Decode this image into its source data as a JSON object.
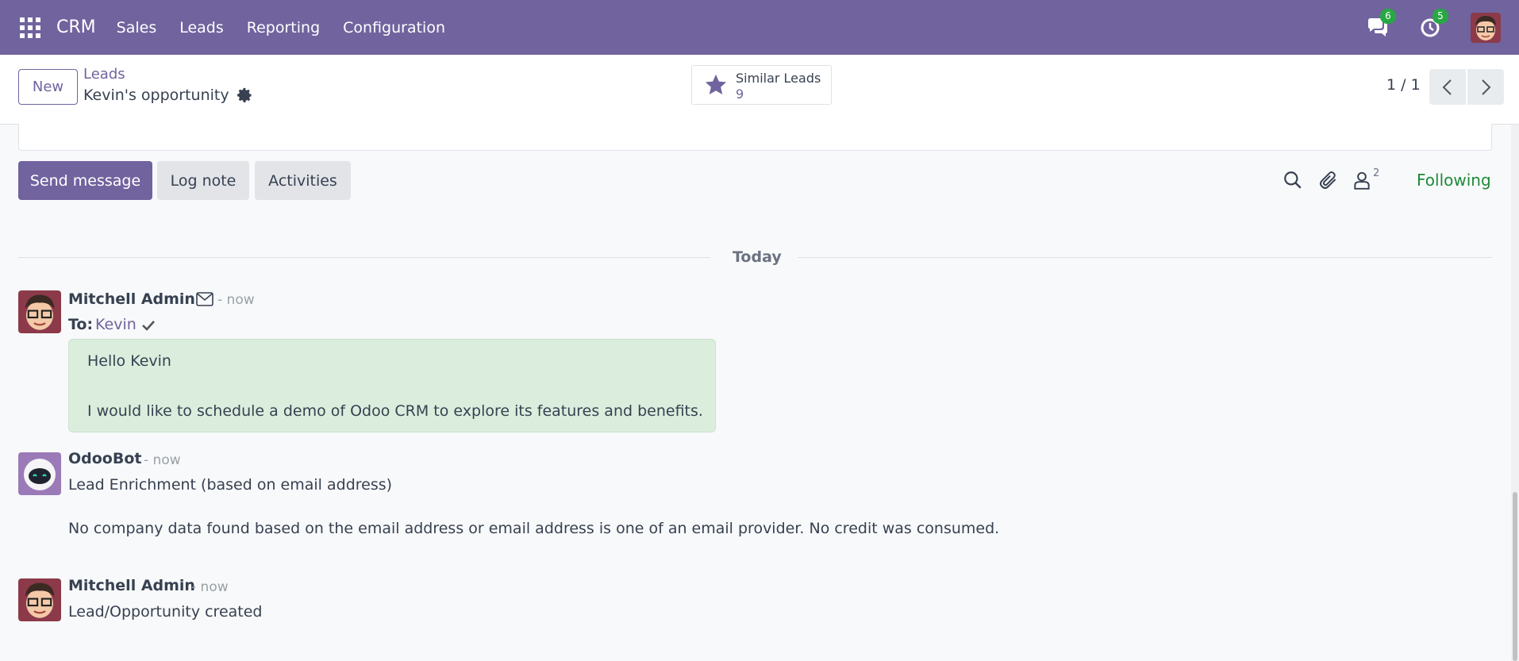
{
  "navbar": {
    "app_name": "CRM",
    "menu": [
      "Sales",
      "Leads",
      "Reporting",
      "Configuration"
    ],
    "messages_count": "6",
    "activities_count": "5",
    "bg_color": "#71639e"
  },
  "control_panel": {
    "new_label": "New",
    "breadcrumb_parent": "Leads",
    "record_title": "Kevin's opportunity",
    "smart_button": {
      "label": "Similar Leads",
      "value": "9"
    },
    "pager": "1 / 1"
  },
  "chatter": {
    "send_message": "Send message",
    "log_note": "Log note",
    "activities": "Activities",
    "followers_count": "2",
    "following": "Following",
    "date_separator": "Today",
    "messages": [
      {
        "author": "Mitchell Admin",
        "time": "- now",
        "to_label": "To:",
        "to_name": "Kevin",
        "body_line1": "Hello Kevin",
        "body_line2": "I would like to schedule a demo of Odoo CRM to explore its features and benefits."
      },
      {
        "author": "OdooBot",
        "time": "- now",
        "line1": "Lead Enrichment (based on email address)",
        "line2": "No company data found based on the email address or email address is one of an email provider. No credit was consumed."
      },
      {
        "author": "Mitchell Admin",
        "time": "- now",
        "line1": "Lead/Opportunity created"
      }
    ]
  },
  "icons": [
    "apps-icon",
    "chat-icon",
    "clock-icon",
    "gear-icon",
    "star-icon",
    "chevron-left-icon",
    "chevron-right-icon",
    "search-icon",
    "paperclip-icon",
    "user-icon",
    "envelope-icon",
    "check-icon"
  ]
}
